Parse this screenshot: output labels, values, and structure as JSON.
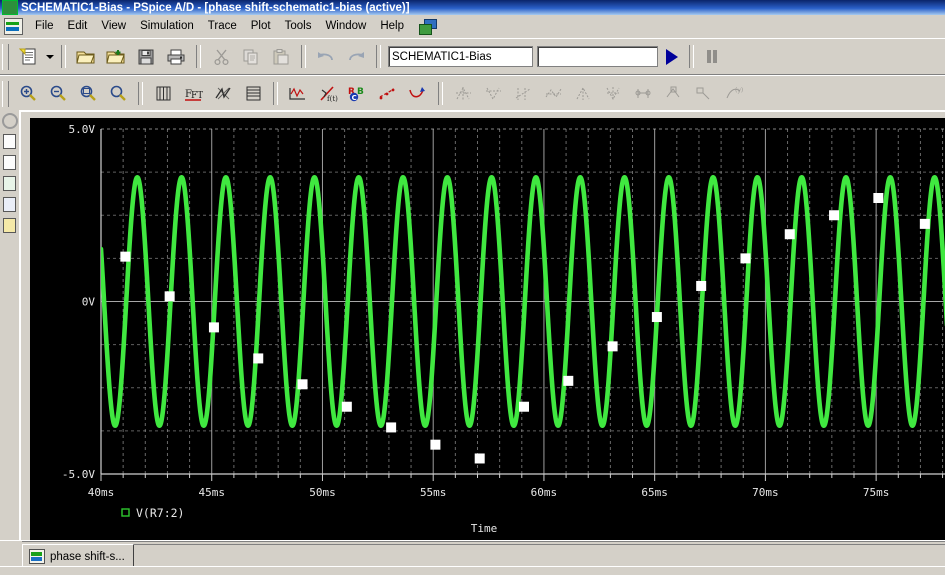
{
  "window": {
    "title": "SCHEMATIC1-Bias - PSpice A/D  - [phase shift-schematic1-bias (active)]",
    "app_icon": "pspice-waveform-icon"
  },
  "menubar": {
    "app_icon": "pspice-document-icon",
    "mdi_icon": "mdi-windows-icon",
    "items": [
      {
        "label": "File"
      },
      {
        "label": "Edit"
      },
      {
        "label": "View"
      },
      {
        "label": "Simulation"
      },
      {
        "label": "Trace"
      },
      {
        "label": "Plot"
      },
      {
        "label": "Tools"
      },
      {
        "label": "Window"
      },
      {
        "label": "Help"
      }
    ]
  },
  "toolbar_main": {
    "buttons": [
      {
        "name": "new-document-icon",
        "enabled": true
      },
      {
        "name": "new-document-dropdown-icon",
        "enabled": true
      },
      {
        "name": "open-file-icon",
        "enabled": true
      },
      {
        "name": "open-simulation-icon",
        "enabled": true
      },
      {
        "name": "save-icon",
        "enabled": true
      },
      {
        "name": "print-icon",
        "enabled": true
      },
      {
        "name": "cut-icon",
        "enabled": false
      },
      {
        "name": "copy-icon",
        "enabled": false
      },
      {
        "name": "paste-icon",
        "enabled": false
      },
      {
        "name": "undo-icon",
        "enabled": false
      },
      {
        "name": "redo-icon",
        "enabled": false
      }
    ],
    "profile_combo_value": "SCHEMATIC1-Bias",
    "profile_combo_placeholder": "",
    "second_combo_value": "",
    "second_combo_placeholder": "",
    "run_button": "run-simulation-icon",
    "pause_button": "pause-simulation-icon"
  },
  "toolbar_plot": {
    "buttons": [
      {
        "name": "zoom-in-icon",
        "enabled": true
      },
      {
        "name": "zoom-out-icon",
        "enabled": true
      },
      {
        "name": "zoom-area-icon",
        "enabled": true
      },
      {
        "name": "zoom-fit-icon",
        "enabled": true
      },
      {
        "name": "view-simulation-output-icon",
        "enabled": true
      },
      {
        "name": "fourier-icon",
        "enabled": true
      },
      {
        "name": "performance-analysis-icon",
        "enabled": true
      },
      {
        "name": "log-x-axis-icon",
        "enabled": true
      },
      {
        "name": "add-trace-icon",
        "enabled": true
      },
      {
        "name": "delete-trace-icon",
        "enabled": true
      },
      {
        "name": "voltage-marker-icon",
        "enabled": true
      },
      {
        "name": "current-marker-icon",
        "enabled": true
      },
      {
        "name": "power-marker-icon",
        "enabled": true
      },
      {
        "name": "cursor-toggle-icon",
        "enabled": false
      },
      {
        "name": "cursor-peak-icon",
        "enabled": false
      },
      {
        "name": "cursor-trough-icon",
        "enabled": false
      },
      {
        "name": "cursor-slope-icon",
        "enabled": false
      },
      {
        "name": "cursor-min-icon",
        "enabled": false
      },
      {
        "name": "cursor-max-icon",
        "enabled": false
      },
      {
        "name": "cursor-point-icon",
        "enabled": false
      },
      {
        "name": "cursor-search-icon",
        "enabled": false
      },
      {
        "name": "mark-label-icon",
        "enabled": false
      },
      {
        "name": "cursor-freeze-icon",
        "enabled": false
      }
    ]
  },
  "left_toolbar": {
    "buttons": [
      {
        "name": "simulation-status-icon"
      },
      {
        "name": "output-file-icon"
      },
      {
        "name": "watch-window-icon"
      },
      {
        "name": "probe-window-icon"
      },
      {
        "name": "simulation-messages-icon"
      },
      {
        "name": "device-list-icon"
      }
    ]
  },
  "tabstrip": {
    "tabs": [
      {
        "label": "phase shift-s...",
        "icon": "waveform-tab-icon",
        "active": true
      }
    ]
  },
  "plot": {
    "background": "#000000",
    "trace_color": "#40e840",
    "marker_color": "#ffffff",
    "grid_color": "#b0b0b0",
    "axis_color": "#d0d0d0",
    "text_color": "#e8e8e8",
    "legend": {
      "symbol": "legend-square-icon",
      "label": "V(R7:2)",
      "color": "#2ec82e"
    }
  },
  "chart_data": {
    "type": "line",
    "title": "",
    "xlabel": "Time",
    "ylabel": "",
    "xlim": [
      40,
      78.2
    ],
    "ylim": [
      -5.0,
      5.0
    ],
    "x_unit": "ms",
    "y_unit": "V",
    "xticks": [
      40,
      45,
      50,
      55,
      60,
      65,
      70,
      75
    ],
    "xtick_labels": [
      "40ms",
      "45ms",
      "50ms",
      "55ms",
      "60ms",
      "65ms",
      "70ms",
      "75ms"
    ],
    "yticks": [
      -5.0,
      0.0,
      5.0
    ],
    "ytick_labels": [
      "-5.0V",
      "0V",
      "5.0V"
    ],
    "y_minor_divisions": 4,
    "x_minor_divisions": 5,
    "grid": true,
    "grid_style": "dashed",
    "legend_position": "below-axis-left",
    "series": [
      {
        "name": "V(R7:2)",
        "color": "#40e840",
        "style": "line",
        "amplitude": 3.6,
        "offset": 0.0,
        "frequency_khz": 0.5,
        "phase_deg": 155,
        "description": "Sine wave oscillation, peak amplitude 3.6 V about 0 V, period 2 ms"
      },
      {
        "name": "sample-markers",
        "color": "#ffffff",
        "style": "markers",
        "marker": "square",
        "description": "Marker samples drifting down then back up (beat with sweep)",
        "points": [
          {
            "t": 41.1,
            "v": 1.3
          },
          {
            "t": 43.1,
            "v": 0.15
          },
          {
            "t": 45.1,
            "v": -0.75
          },
          {
            "t": 47.1,
            "v": -1.65
          },
          {
            "t": 49.1,
            "v": -2.4
          },
          {
            "t": 51.1,
            "v": -3.05
          },
          {
            "t": 53.1,
            "v": -3.65
          },
          {
            "t": 55.1,
            "v": -4.15
          },
          {
            "t": 57.1,
            "v": -4.55
          },
          {
            "t": 59.1,
            "v": -3.05
          },
          {
            "t": 61.1,
            "v": -2.3
          },
          {
            "t": 63.1,
            "v": -1.3
          },
          {
            "t": 65.1,
            "v": -0.45
          },
          {
            "t": 67.1,
            "v": 0.45
          },
          {
            "t": 69.1,
            "v": 1.25
          },
          {
            "t": 71.1,
            "v": 1.95
          },
          {
            "t": 73.1,
            "v": 2.5
          },
          {
            "t": 75.1,
            "v": 3.0
          },
          {
            "t": 77.2,
            "v": 2.25
          }
        ]
      }
    ]
  }
}
